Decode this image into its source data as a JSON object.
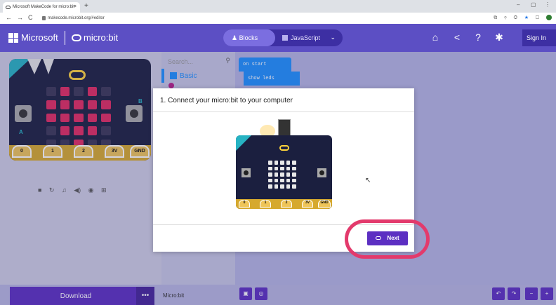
{
  "browser": {
    "tab_title": "Microsoft MakeCode for micro:bit",
    "tab_close": "×",
    "new_tab": "+",
    "nav_back": "←",
    "nav_forward": "→",
    "nav_reload": "C",
    "url": "makecode.microbit.org/#editor",
    "win_min": "–",
    "win_restore": "▢",
    "win_close": "⋮"
  },
  "header": {
    "brand": "Microsoft",
    "product": "micro:bit",
    "blocks_label": "Blocks",
    "javascript_label": "JavaScript",
    "signin_label": "Sign In"
  },
  "toolbox": {
    "search_placeholder": "Search...",
    "categories": [
      {
        "label": "Basic"
      }
    ]
  },
  "simulator": {
    "leds": [
      0,
      1,
      0,
      1,
      0,
      1,
      1,
      1,
      1,
      1,
      1,
      1,
      1,
      1,
      1,
      0,
      1,
      1,
      1,
      0,
      0,
      0,
      1,
      0,
      0
    ],
    "pin_labels": [
      "0",
      "1",
      "2",
      "3V",
      "GND"
    ],
    "button_a": "A",
    "button_b": "B",
    "controls": "■ ↻ ♫ ◀) ◉ ⊞"
  },
  "workspace": {
    "on_start": "on start",
    "show_leds": "show leds"
  },
  "dialog": {
    "title": "1. Connect your micro:bit to your computer",
    "next_label": "Next",
    "mini_pins": [
      "0",
      "1",
      "2",
      "3V",
      "GND"
    ]
  },
  "bottom": {
    "download_label": "Download",
    "more_label": "•••",
    "project_name": "Micro:bit"
  }
}
